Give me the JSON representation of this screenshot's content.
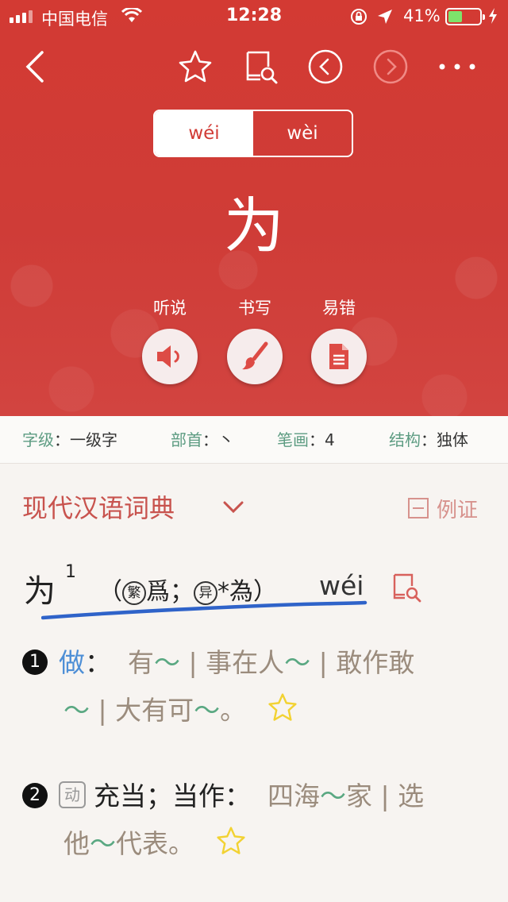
{
  "status_bar": {
    "carrier": "中国电信",
    "time": "12:28",
    "battery_percent": "41%",
    "battery_level": 0.41
  },
  "nav": {
    "icons": [
      "back-icon",
      "star-icon",
      "book-search-icon",
      "prev-icon",
      "next-icon",
      "more-icon"
    ]
  },
  "pinyin_tabs": [
    {
      "label": "wéi",
      "active": true
    },
    {
      "label": "wèi",
      "active": false
    }
  ],
  "character": "为",
  "actions": [
    {
      "label": "听说",
      "icon": "speaker-icon"
    },
    {
      "label": "书写",
      "icon": "brush-icon"
    },
    {
      "label": "易错",
      "icon": "document-icon"
    }
  ],
  "info": {
    "level_key": "字级",
    "level_val": "一级字",
    "radical_key": "部首",
    "radical_val": "丶",
    "strokes_key": "笔画",
    "strokes_val": "4",
    "structure_key": "结构",
    "structure_val": "独体"
  },
  "dictionary": {
    "title": "现代汉语词典",
    "example_label": "例证",
    "headword": {
      "char": "为",
      "sup": "1",
      "trad_tag": "繁",
      "trad_char": "爲",
      "variant_tag": "异",
      "variant_char": "*為",
      "pinyin": "wéi"
    },
    "definitions": [
      {
        "num": "1",
        "word": "做",
        "line1": [
          "有",
          "～",
          " | 事在人",
          "～",
          " | 敢作敢"
        ],
        "line2": [
          "～",
          " | 大有可",
          "～",
          "。"
        ]
      },
      {
        "num": "2",
        "tag": "动",
        "word": "充当；当作",
        "line1": [
          "四海",
          "～",
          "家 | 选"
        ],
        "line2": [
          "他",
          "～",
          "代表。"
        ]
      }
    ]
  },
  "colors": {
    "brand_red": "#d13b35",
    "link_blue": "#4e8fd6",
    "tilde_green": "#5aa882",
    "meta_green": "#5d9c82",
    "star_yellow": "#f2d232"
  }
}
